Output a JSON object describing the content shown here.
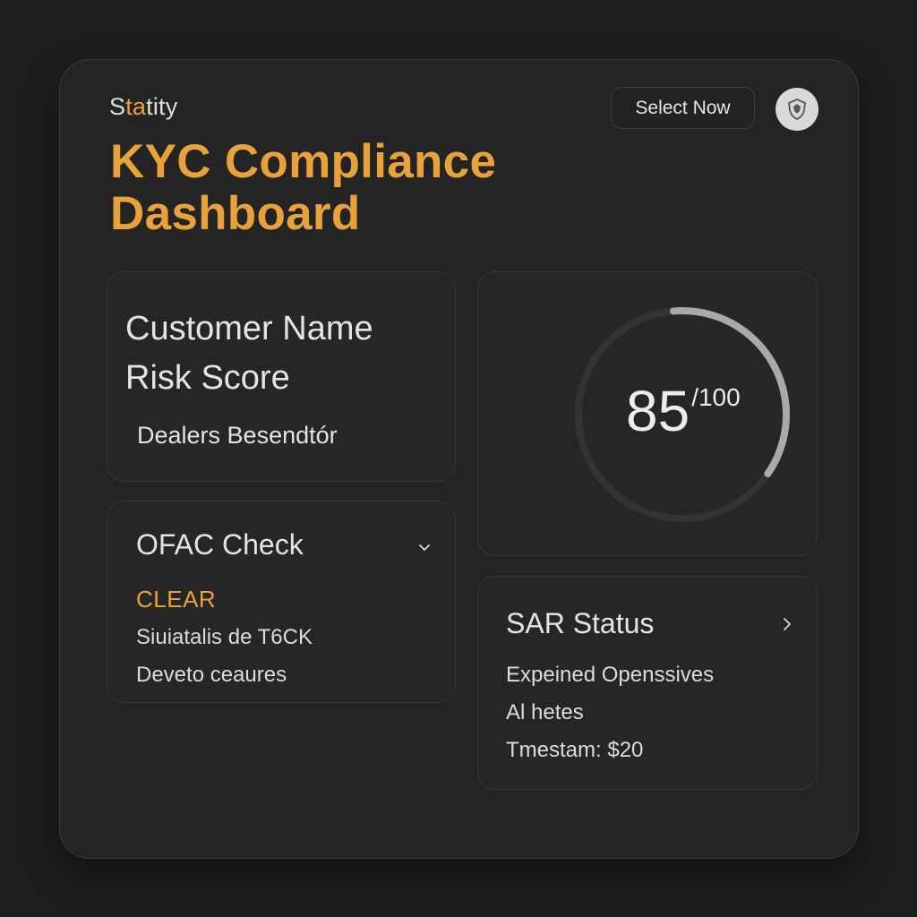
{
  "header": {
    "brand_prefix": "S",
    "brand_accent": "ta",
    "brand_suffix": "tity",
    "select_button_label": "Select Now",
    "avatar_icon": "shield-icon",
    "title_line1": "KYC Compliance",
    "title_line2": "Dashboard"
  },
  "customer_card": {
    "heading_line1": "Customer Name",
    "heading_line2": "Risk Score",
    "customer_name": "Dealers Besendtór"
  },
  "risk_gauge": {
    "score": "85",
    "max_label": "/100",
    "progress_fraction": 0.36
  },
  "ofac_card": {
    "title": "OFAC Check",
    "status": "CLEAR",
    "line1": "Siuiatalis de T6CK",
    "line2": "Deveto ceaures",
    "expand_icon": "chevron-down-icon"
  },
  "sar_card": {
    "title": "SAR Status",
    "line1": "Expeined Openssives",
    "line2": "Al hetes",
    "line3": "Tmestam: $20",
    "open_icon": "chevron-right-icon"
  },
  "colors": {
    "accent": "#e9a23b",
    "background": "#1e1e1f",
    "panel": "#242425",
    "gauge_track": "#333335",
    "gauge_progress": "#a9a9a9"
  }
}
